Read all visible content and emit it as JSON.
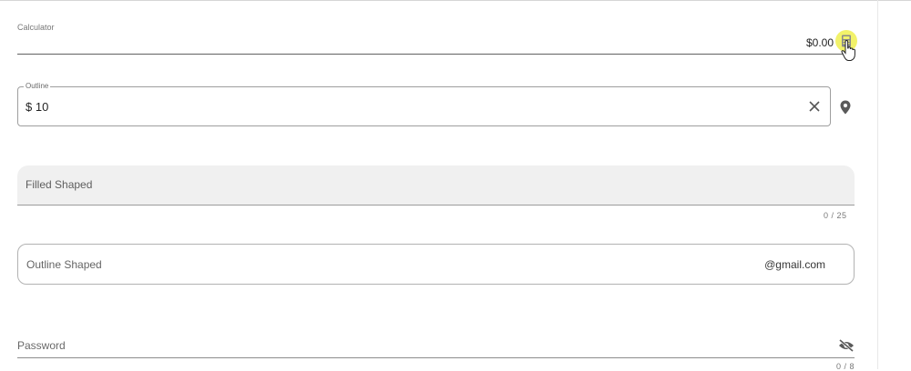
{
  "calculator": {
    "label": "Calculator",
    "value": "$0.00",
    "icon": "calculator-icon"
  },
  "outline": {
    "label": "Outline",
    "value": "$ 10",
    "clear_icon": "close-icon",
    "append_icon": "map-marker-icon"
  },
  "filled_shaped": {
    "label": "Filled Shaped",
    "counter": "0 / 25"
  },
  "outline_shaped": {
    "label": "Outline Shaped",
    "suffix": "@gmail.com"
  },
  "password": {
    "label": "Password",
    "counter": "0 / 8",
    "icon": "eye-off-icon"
  },
  "colors": {
    "highlight": "#f2f26a",
    "filled_bg": "#f0f0f0"
  }
}
